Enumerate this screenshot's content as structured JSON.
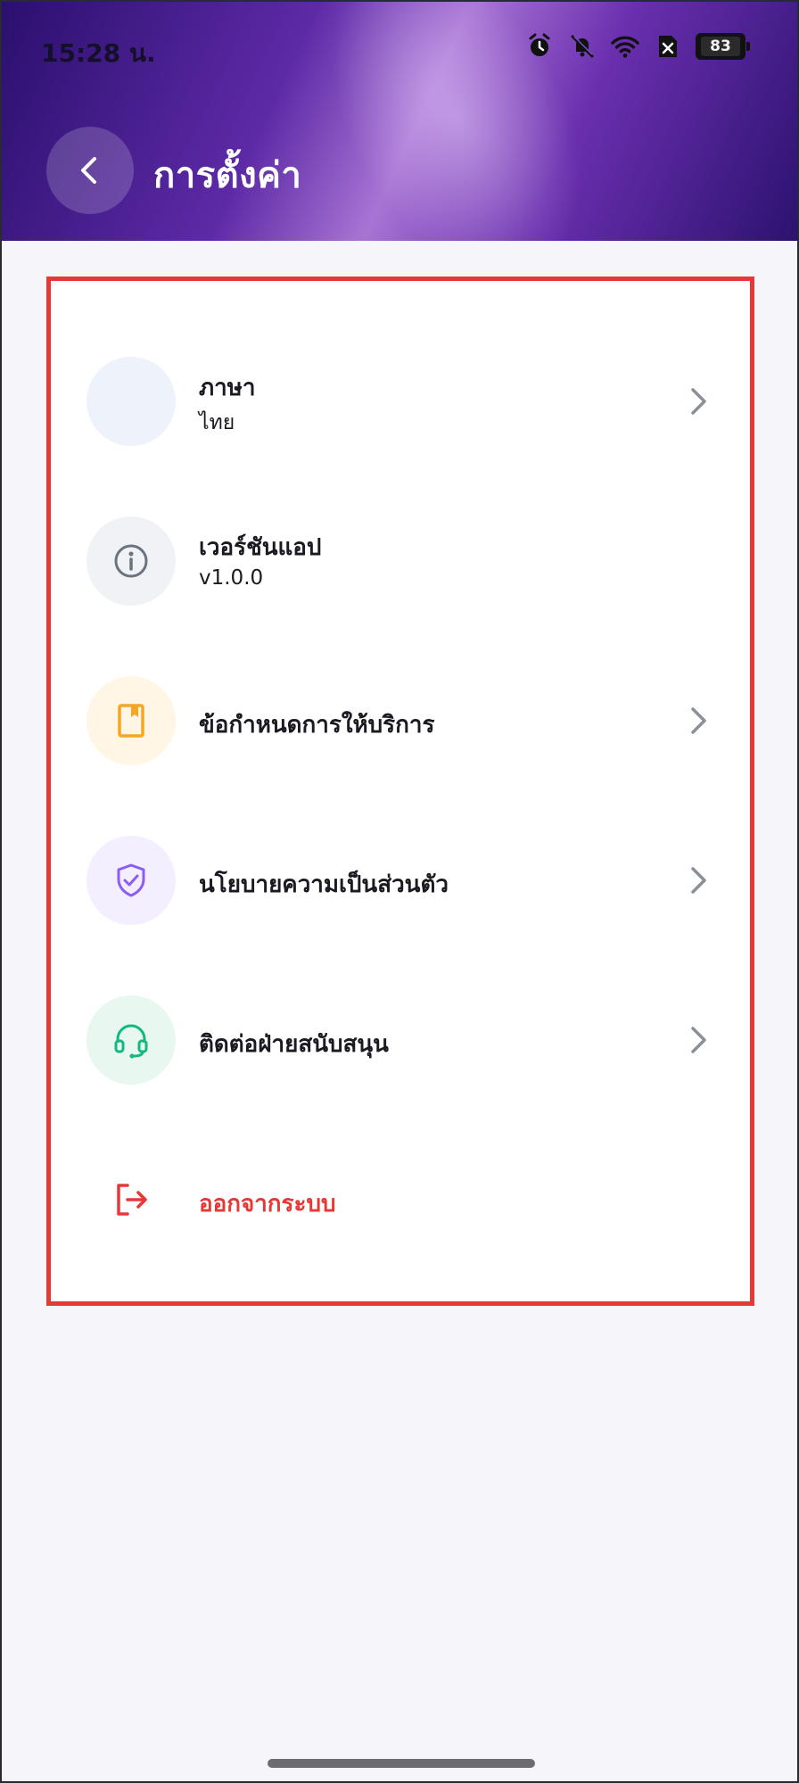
{
  "status_bar": {
    "time": "15:28 น.",
    "icons": [
      "alarm-icon",
      "bell-off-icon",
      "wifi-icon",
      "no-sim-icon"
    ],
    "battery": "83"
  },
  "header": {
    "title": "การตั้งค่า",
    "back_icon": "chevron-left-icon"
  },
  "settings": {
    "language": {
      "title": "ภาษา",
      "subtitle": "ไทย",
      "icon": "language-icon"
    },
    "version": {
      "title": "เวอร์ชันแอป",
      "subtitle": "v1.0.0",
      "icon": "info-icon"
    },
    "terms": {
      "title": "ข้อกำหนดการให้บริการ",
      "icon": "book-icon"
    },
    "privacy": {
      "title": "นโยบายความเป็นส่วนตัว",
      "icon": "shield-check-icon"
    },
    "support": {
      "title": "ติดต่อฝ่ายสนับสนุน",
      "icon": "headset-icon"
    },
    "logout": {
      "title": "ออกจากระบบ",
      "icon": "logout-icon"
    }
  },
  "colors": {
    "header_gradient_start": "#2b0f6e",
    "header_gradient_mid": "#a874d4",
    "highlight_border": "#e53935",
    "logout": "#e53935",
    "terms_icon": "#f5a623",
    "privacy_icon": "#8b5cf6",
    "support_icon": "#10b981",
    "info_icon": "#6b7280"
  }
}
